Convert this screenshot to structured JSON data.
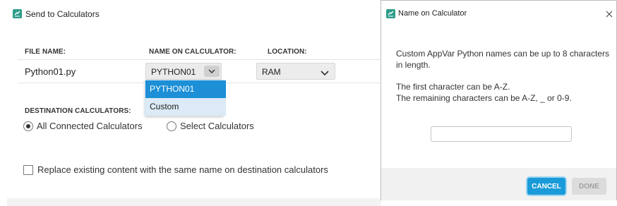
{
  "send_window": {
    "title": "Send to Calculators",
    "columns": {
      "file_name": "FILE NAME:",
      "name_on_calculator": "NAME ON CALCULATOR:",
      "location": "LOCATION:"
    },
    "row": {
      "file_name": "Python01.py",
      "name_value": "PYTHON01",
      "location_value": "RAM"
    },
    "name_dropdown": {
      "options": [
        "PYTHON01",
        "Custom"
      ],
      "highlighted": "PYTHON01"
    },
    "destination": {
      "heading": "DESTINATION CALCULATORS:",
      "option_all": "All Connected Calculators",
      "option_select": "Select Calculators",
      "selected": "All Connected Calculators"
    },
    "replace_label": "Replace existing content with the same name on destination calculators",
    "replace_checked": false
  },
  "name_dialog": {
    "title": "Name on Calculator",
    "line1": "Custom AppVar Python names can be up to 8 characters",
    "line2": "in length.",
    "line3": "The first character can be A-Z.",
    "line4": "The remaining characters can be A-Z, _ or 0-9.",
    "input_value": "",
    "cancel_label": "CANCEL",
    "done_label": "DONE"
  },
  "colors": {
    "accent": "#1a9bd9",
    "highlight_blue": "#1c8fd6",
    "hover_blue": "#dbeaf6",
    "app_icon": "#2e9c8a"
  }
}
